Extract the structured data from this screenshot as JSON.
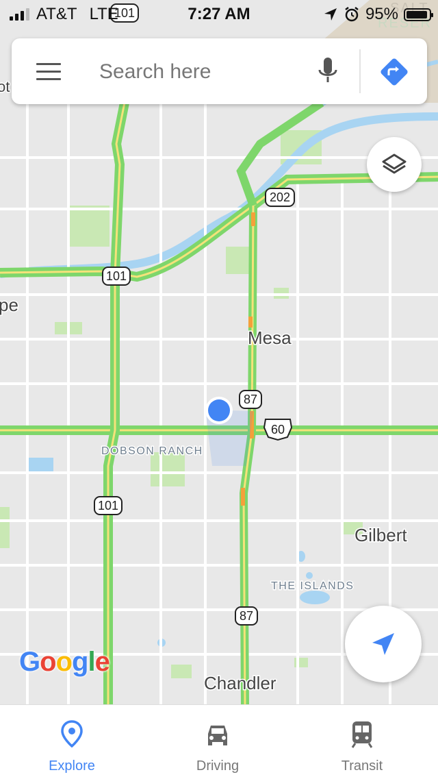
{
  "status_bar": {
    "carrier": "AT&T",
    "network": "LTE",
    "time": "7:27 AM",
    "battery_percent": "95%",
    "signal_bars_filled": 3,
    "signal_bars_total": 4,
    "battery_level": 0.95
  },
  "search": {
    "placeholder": "Search here"
  },
  "map": {
    "place_labels": {
      "mesa": "Mesa",
      "dobson_ranch": "DOBSON RANCH",
      "gilbert": "Gilbert",
      "the_islands": "THE ISLANDS",
      "chandler": "Chandler",
      "tempe_partial": "pe",
      "top_left_partial": "ot",
      "salt_river_partial_1": "SALT",
      "salt_river_partial_2": "RESER"
    },
    "route_shields": {
      "r101_top": "101",
      "r202": "202",
      "r101_mid": "101",
      "r87_upper": "87",
      "us60": "60",
      "r101_lower": "101",
      "r87_lower": "87"
    },
    "colors": {
      "background": "#e8e8e8",
      "road_minor": "#ffffff",
      "traffic_green": "#7ed66b",
      "traffic_orange": "#f4a03a",
      "highway_core": "#f5e27a",
      "water": "#a8d4f2",
      "park": "#c9e8b4",
      "location_dot": "#4285f4"
    }
  },
  "google_logo": {
    "letters": [
      "G",
      "o",
      "o",
      "g",
      "l",
      "e"
    ],
    "colors": [
      "#4285f4",
      "#ea4335",
      "#fbbc05",
      "#4285f4",
      "#34a853",
      "#ea4335"
    ]
  },
  "bottom_nav": {
    "items": [
      {
        "label": "Explore",
        "icon": "map-pin-icon",
        "active": true
      },
      {
        "label": "Driving",
        "icon": "car-icon",
        "active": false
      },
      {
        "label": "Transit",
        "icon": "train-icon",
        "active": false
      }
    ]
  },
  "accent_color": "#4285f4"
}
